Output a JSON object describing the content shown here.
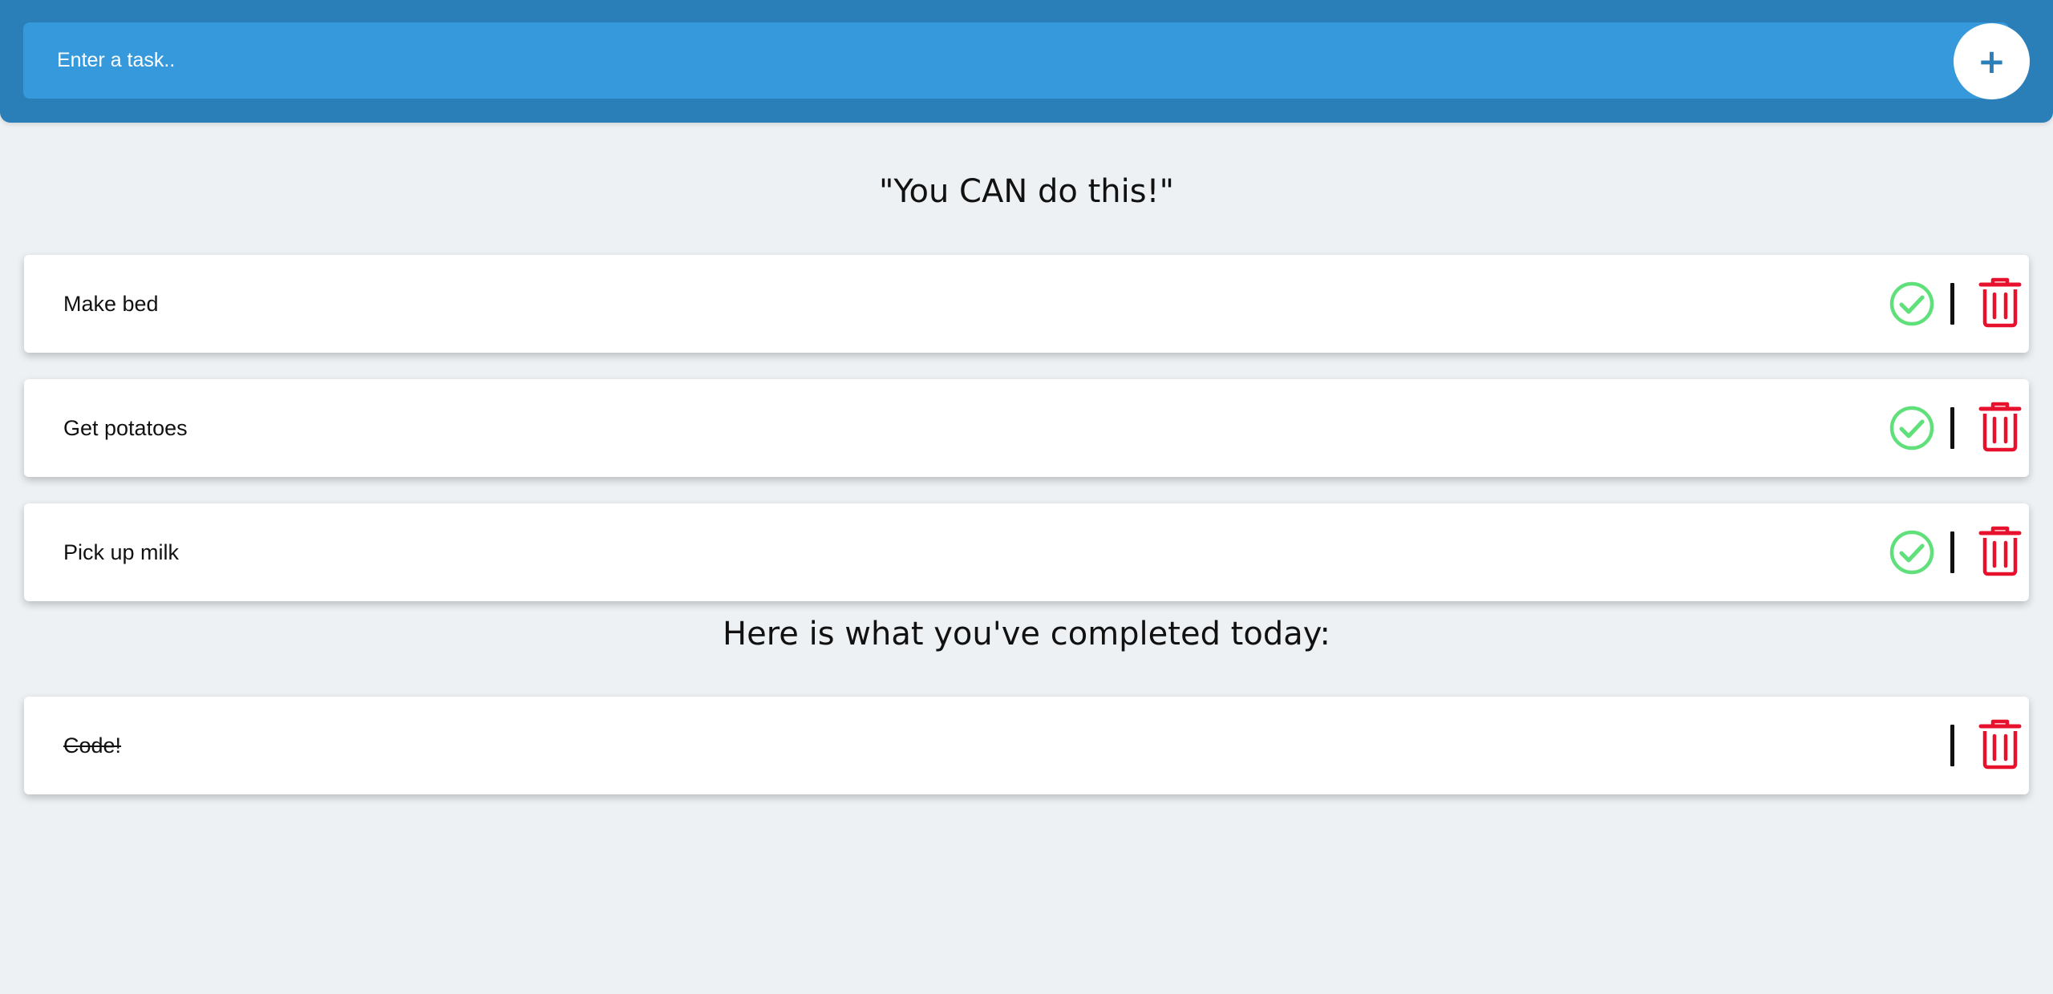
{
  "header": {
    "input_placeholder": "Enter a task..",
    "input_value": "",
    "add_label": "+"
  },
  "quote": "\"You CAN do this!\"",
  "todo_tasks": [
    {
      "label": "Make bed"
    },
    {
      "label": "Get potatoes"
    },
    {
      "label": "Pick up milk"
    }
  ],
  "completed_heading": "Here is what you've completed today:",
  "completed_tasks": [
    {
      "label": "Code!"
    }
  ],
  "icons": {
    "add": "plus-icon",
    "complete": "check-circle-icon",
    "delete": "trash-icon"
  },
  "colors": {
    "header_bg": "#2a7fb8",
    "input_bg": "#3699dc",
    "page_bg": "#edf1f4",
    "check": "#5fe07a",
    "trash": "#e8112d"
  }
}
